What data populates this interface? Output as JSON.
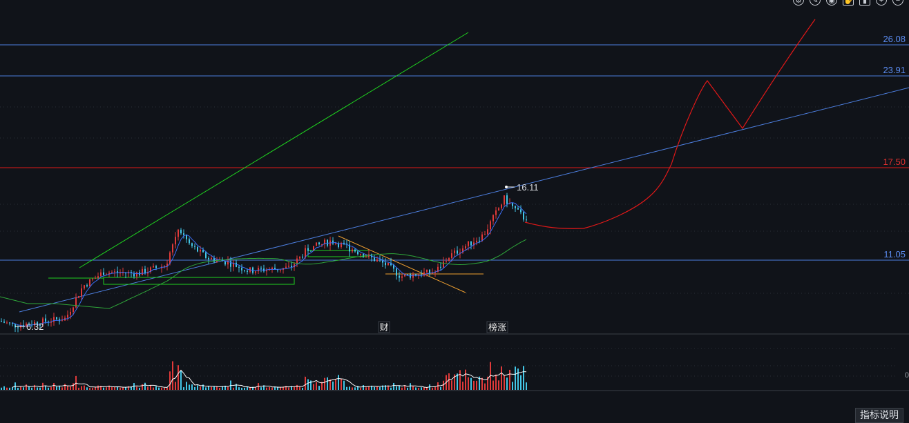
{
  "toolbar": {
    "icons": [
      "settings-icon",
      "brush-icon",
      "eye-icon",
      "hand-icon",
      "trash-icon",
      "zoom-in-icon",
      "zoom-out-icon"
    ]
  },
  "help_button": "指标说明",
  "colors": {
    "background": "#101319",
    "blue_line": "#4d7fe0",
    "red_line": "#e01818",
    "green_line": "#1fd21f",
    "orange_line": "#f0a030",
    "candle_up": "#e03a3a",
    "candle_down": "#43c6e6",
    "ma_short": "#3b6ef5",
    "ma_long": "#2fa83a",
    "label_blue": "#5b8cf0",
    "label_red": "#e03030"
  },
  "chart_data": {
    "type": "candlestick",
    "price_labels": [
      {
        "value": 26.08,
        "text": "26.08",
        "color": "blue"
      },
      {
        "value": 23.91,
        "text": "23.91",
        "color": "blue"
      },
      {
        "value": 17.5,
        "text": "17.50",
        "color": "red"
      },
      {
        "value": 11.05,
        "text": "11.05",
        "color": "blue"
      }
    ],
    "high_marker": {
      "value": 16.11,
      "text": "16.11"
    },
    "low_marker": {
      "value": 6.32,
      "text": "6.32"
    },
    "event_markers": [
      {
        "text": "财"
      },
      {
        "text": "榜涨"
      }
    ],
    "volume_axis_label": "0"
  }
}
